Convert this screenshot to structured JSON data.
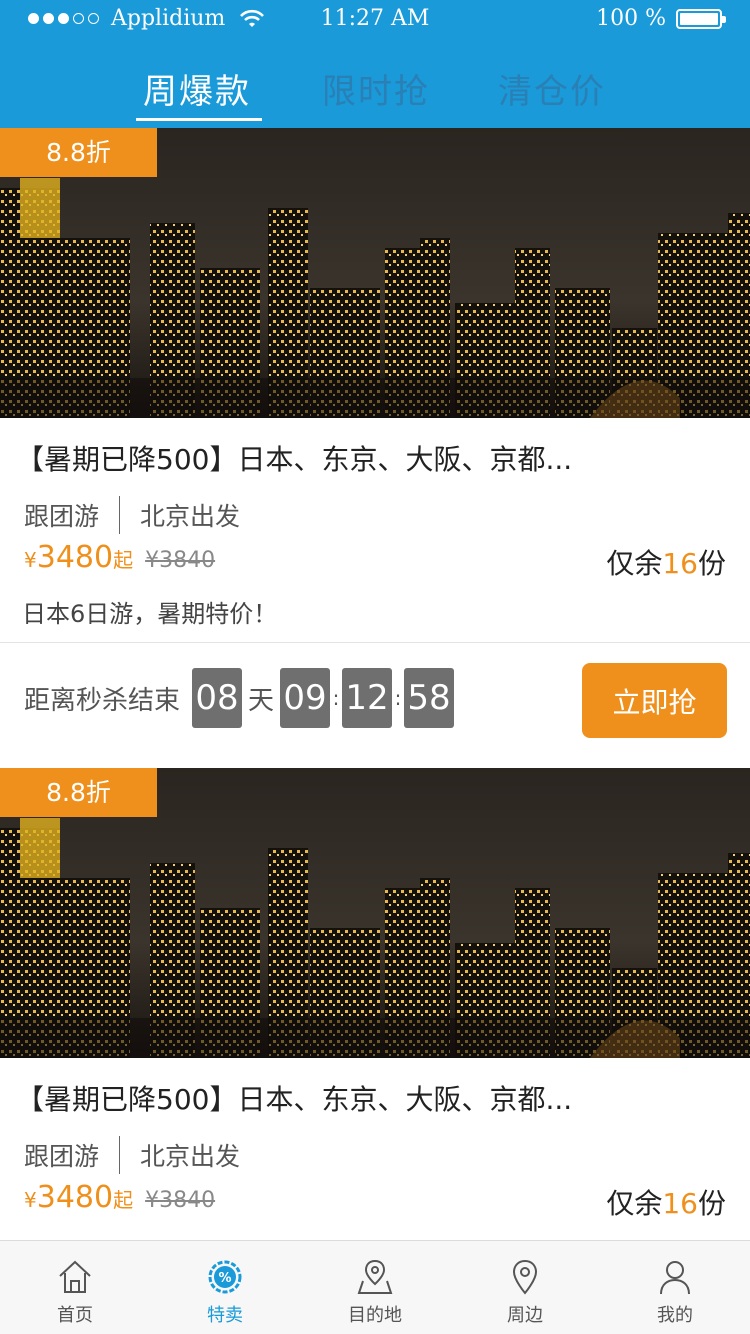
{
  "status_bar": {
    "carrier": "Applidium",
    "time": "11:27 AM",
    "battery": "100 %"
  },
  "tabs": [
    {
      "label": "周爆款",
      "active": true
    },
    {
      "label": "限时抢",
      "active": false
    },
    {
      "label": "清仓价",
      "active": false
    }
  ],
  "cards": [
    {
      "discount": "8.8折",
      "title": "【暑期已降500】日本、东京、大阪、京都...",
      "tag_type": "跟团游",
      "tag_departure": "北京出发",
      "currency": "¥",
      "price": "3480",
      "price_suffix": "起",
      "original_price": "¥3840",
      "remain_prefix": "仅余",
      "remain_count": "16",
      "remain_suffix": "份",
      "description": "日本6日游，暑期特价！",
      "countdown": {
        "label": "距离秒杀结束",
        "days": "08",
        "days_unit": "天",
        "hours": "09",
        "minutes": "12",
        "seconds": "58"
      },
      "buy_label": "立即抢"
    },
    {
      "discount": "8.8折",
      "title": "【暑期已降500】日本、东京、大阪、京都...",
      "tag_type": "跟团游",
      "tag_departure": "北京出发",
      "currency": "¥",
      "price": "3480",
      "price_suffix": "起",
      "original_price": "¥3840",
      "remain_prefix": "仅余",
      "remain_count": "16",
      "remain_suffix": "份"
    }
  ],
  "bottom_nav": [
    {
      "label": "首页",
      "icon": "home-icon",
      "active": false
    },
    {
      "label": "特卖",
      "icon": "percent-badge-icon",
      "active": true
    },
    {
      "label": "目的地",
      "icon": "map-pin-icon",
      "active": false
    },
    {
      "label": "周边",
      "icon": "location-pin-icon",
      "active": false
    },
    {
      "label": "我的",
      "icon": "user-icon",
      "active": false
    }
  ],
  "colors": {
    "primary": "#1a9ad9",
    "accent": "#f0901c",
    "digit_bg": "#6f6f6f"
  }
}
